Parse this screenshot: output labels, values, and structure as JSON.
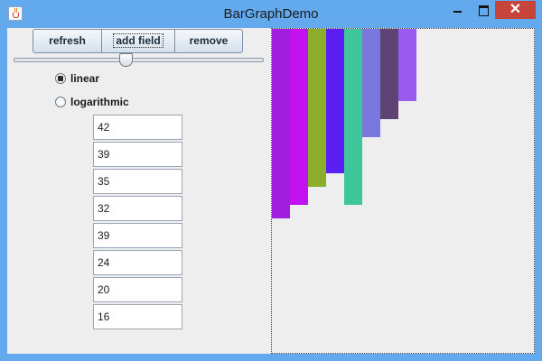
{
  "window": {
    "title": "BarGraphDemo",
    "close_glyph": "✕"
  },
  "toolbar": {
    "refresh": "refresh",
    "add_field": "add field",
    "remove": "remove"
  },
  "scale_slider": {
    "value_fraction": 0.45
  },
  "scale_options": {
    "linear": "linear",
    "logarithmic": "logarithmic",
    "selected": "linear"
  },
  "fields": [
    "42",
    "39",
    "35",
    "32",
    "39",
    "24",
    "20",
    "16"
  ],
  "graph": {
    "max_value": 42,
    "bar_colors": [
      "#a11de0",
      "#c212f0",
      "#8aad2a",
      "#5a1ef5",
      "#3ec79a",
      "#7a78de",
      "#5f4375",
      "#9a5cf0"
    ]
  }
}
